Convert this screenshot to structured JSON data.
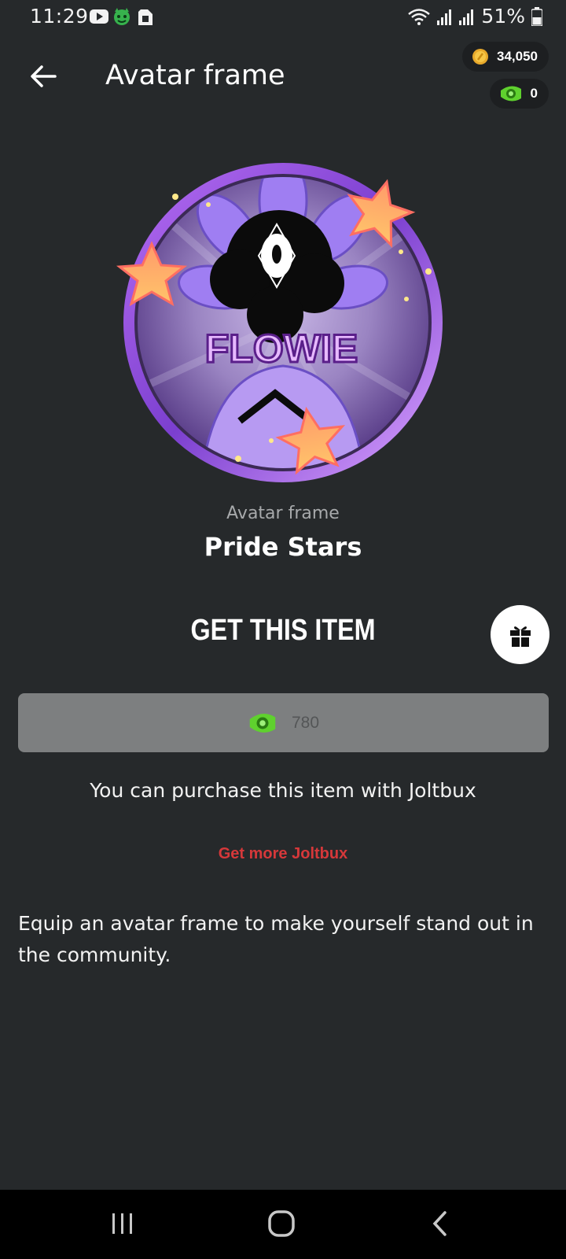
{
  "status_bar": {
    "time": "11:29",
    "battery": "51%",
    "left_icons": [
      "youtube-icon",
      "app-mascot-icon",
      "sim-card-icon"
    ],
    "right_icons": [
      "wifi-icon",
      "signal-icon",
      "signal-icon",
      "battery-icon"
    ]
  },
  "header": {
    "title": "Avatar frame",
    "back_icon": "arrow-left-icon"
  },
  "wallet": {
    "coins": "34,050",
    "joltbux": "0"
  },
  "item": {
    "type_label": "Avatar frame",
    "name": "Pride Stars",
    "avatar_text": "FLOWIE"
  },
  "purchase": {
    "heading": "GET THIS ITEM",
    "price": "780",
    "note": "You can purchase this item with Joltbux",
    "get_more_label": "Get more Joltbux",
    "description": "Equip an avatar frame to make yourself stand out in the community."
  },
  "colors": {
    "background": "#26292b",
    "link_red": "#d6383a",
    "button_grey": "#7d7f80",
    "frame_purple": "#9a5ee0",
    "star_orange": "#ff8a5c"
  }
}
